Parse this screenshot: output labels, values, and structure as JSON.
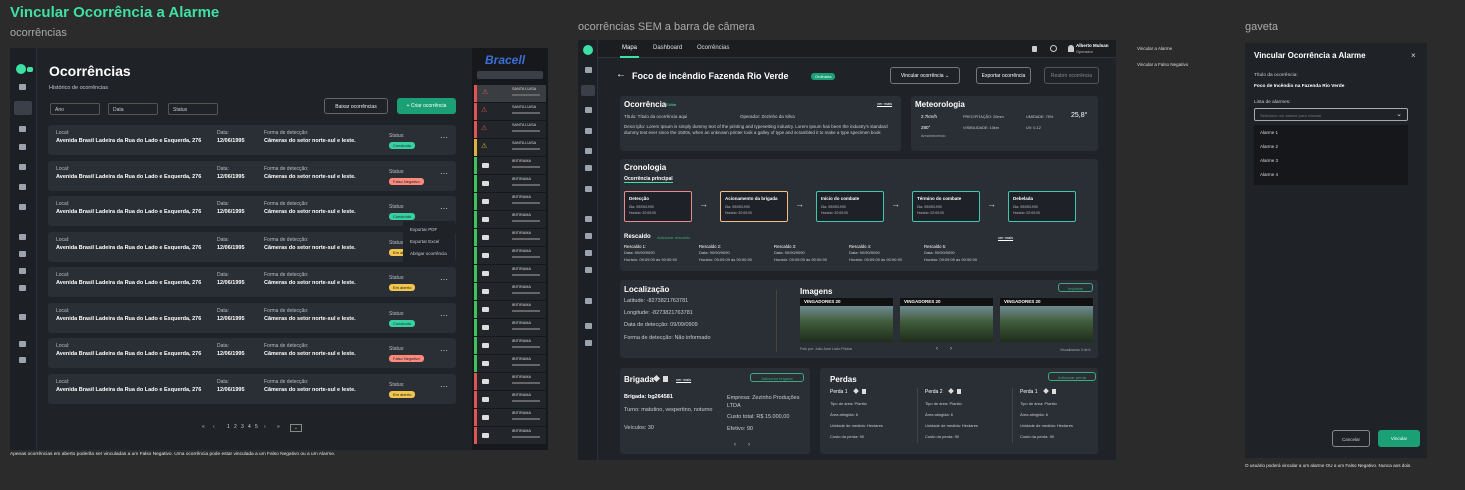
{
  "title": "Vincular Ocorrência a Alarme",
  "frames": {
    "f1": "ocorrências",
    "f2": "ocorrências SEM a barra de câmera",
    "f3": "gaveta"
  },
  "list": {
    "page_title": "Ocorrências",
    "subtitle": "Histórico de ocorrências",
    "filters": [
      "Ano",
      "Data",
      "Status"
    ],
    "download_label": "Baixar ocorrências",
    "create_label": "+ Criar ocorrência",
    "rows": [
      {
        "local_label": "Local:",
        "local": "Avenida Brasil Ladeira da Rua do Lado e Esquerda, 276",
        "data_label": "Data:",
        "data": "12/06/1995",
        "forma_label": "Forma de detecção:",
        "forma": "Câmeras do setor norte-sul e leste.",
        "status_label": "Status:",
        "status": "Concluído",
        "color": "#39d0a0"
      },
      {
        "local_label": "Local:",
        "local": "Avenida Brasil Ladeira da Rua do Lado e Esquerda, 276",
        "data_label": "Data:",
        "data": "12/06/1995",
        "forma_label": "Forma de detecção:",
        "forma": "Câmeras do setor norte-sul e leste.",
        "status_label": "Status:",
        "status": "Falso Negativo",
        "color": "#ff8a7a"
      },
      {
        "local_label": "Local:",
        "local": "Avenida Brasil Ladeira da Rua do Lado e Esquerda, 276",
        "data_label": "Data:",
        "data": "12/06/1995",
        "forma_label": "Forma de detecção:",
        "forma": "Câmeras do setor norte-sul e leste.",
        "status_label": "Status:",
        "status": "Concluído",
        "color": "#39d0a0"
      },
      {
        "local_label": "Local:",
        "local": "Avenida Brasil Ladeira da Rua do Lado e Esquerda, 276",
        "data_label": "Data:",
        "data": "12/06/1995",
        "forma_label": "Forma de detecção:",
        "forma": "Câmeras do setor norte-sul e leste.",
        "status_label": "Status:",
        "status": "Em aberto",
        "color": "#f3c54a"
      },
      {
        "local_label": "Local:",
        "local": "Avenida Brasil Ladeira da Rua do Lado e Esquerda, 276",
        "data_label": "Data:",
        "data": "12/06/1995",
        "forma_label": "Forma de detecção:",
        "forma": "Câmeras do setor norte-sul e leste.",
        "status_label": "Status:",
        "status": "Em aberto",
        "color": "#f3c54a"
      },
      {
        "local_label": "Local:",
        "local": "Avenida Brasil Ladeira da Rua do Lado e Esquerda, 276",
        "data_label": "Data:",
        "data": "12/06/1995",
        "forma_label": "Forma de detecção:",
        "forma": "Câmeras do setor norte-sul e leste.",
        "status_label": "Status:",
        "status": "Concluído",
        "color": "#39d0a0"
      },
      {
        "local_label": "Local:",
        "local": "Avenida Brasil Ladeira da Rua do Lado e Esquerda, 276",
        "data_label": "Data:",
        "data": "12/06/1995",
        "forma_label": "Forma de detecção:",
        "forma": "Câmeras do setor norte-sul e leste.",
        "status_label": "Status:",
        "status": "Falso Negativo",
        "color": "#ff8a7a"
      },
      {
        "local_label": "Local:",
        "local": "Avenida Brasil Ladeira da Rua do Lado e Esquerda, 276",
        "data_label": "Data:",
        "data": "12/06/1995",
        "forma_label": "Forma de detecção:",
        "forma": "Câmeras do setor norte-sul e leste.",
        "status_label": "Status:",
        "status": "Em aberto",
        "color": "#f3c54a"
      }
    ],
    "menu": [
      "Exportar PDF",
      "Exportar Excel",
      "Abrigar ocorrência"
    ],
    "pagination": [
      "«",
      "‹",
      "1",
      "2",
      "3",
      "4",
      "5",
      "›",
      "»",
      "⌄"
    ],
    "footnote": "Apenas ocorrências em aberto poderão ser vinculadas a um Falso Negativo. Uma ocorrência pode estar vinculada a um Falso Negativo ou a um Alarme.",
    "brand": "Bracell",
    "alarms": [
      {
        "label": "SANTA LUISA",
        "color": "#e05454",
        "icon": "x"
      },
      {
        "label": "SANTA LUISA",
        "color": "#e05454",
        "icon": "!"
      },
      {
        "label": "SANTA LUISA",
        "color": "#e05454",
        "icon": "!"
      },
      {
        "label": "SANTA LUISA",
        "color": "#e0b13c",
        "icon": "!"
      },
      {
        "label": "IBITIRAMA",
        "color": "#3bc45a",
        "icon": "c"
      },
      {
        "label": "IBITIRAMA",
        "color": "#3bc45a",
        "icon": "c"
      },
      {
        "label": "IBITIRAMA",
        "color": "#3bc45a",
        "icon": "c"
      },
      {
        "label": "IBITIRAMA",
        "color": "#3bc45a",
        "icon": "c"
      },
      {
        "label": "IBITIRAMA",
        "color": "#3bc45a",
        "icon": "c"
      },
      {
        "label": "IBITIRAMA",
        "color": "#3bc45a",
        "icon": "c"
      },
      {
        "label": "IBITIRAMA",
        "color": "#3bc45a",
        "icon": "c"
      },
      {
        "label": "IBITIRAMA",
        "color": "#3bc45a",
        "icon": "c"
      },
      {
        "label": "IBITIRAMA",
        "color": "#3bc45a",
        "icon": "c"
      },
      {
        "label": "IBITIRAMA",
        "color": "#3bc45a",
        "icon": "c"
      },
      {
        "label": "IBITIRAMA",
        "color": "#3bc45a",
        "icon": "c"
      },
      {
        "label": "IBITIRAMA",
        "color": "#3bc45a",
        "icon": "c"
      },
      {
        "label": "IBITIRAMA",
        "color": "#e05454",
        "icon": "c"
      },
      {
        "label": "IBITIRAMA",
        "color": "#e05454",
        "icon": "c"
      },
      {
        "label": "IBITIRAMA",
        "color": "#e05454",
        "icon": "c"
      },
      {
        "label": "IBITIRAMA",
        "color": "#e05454",
        "icon": "c"
      }
    ]
  },
  "detail": {
    "nav": [
      "Mapa",
      "Dashboard",
      "Ocorrências"
    ],
    "user_name": "Alberto Mulsan",
    "user_role": "Operador",
    "title": "Foco de incêndio Fazenda Rio Verde",
    "badge": "Ordinária",
    "link_label": "Vincular ocorrência",
    "export_label": "Exportar ocorrência",
    "reopen_label": "Reabrir ocorrência",
    "occ": {
      "h": "Ocorrência",
      "edit": "Editar",
      "more": "ver mais",
      "title": "Título: Título da ocorrência aqui",
      "operator": "Operador: Zezinho da Silva",
      "desc": "Descrição: Lorem Ipsum is simply dummy text of the printing and typesetting industry. Lorem Ipsum has been the industry's standard dummy text ever since the 1500s, when an unknown printer took a galley of type and scrambled it to make a type specimen book"
    },
    "meteo": {
      "h": "Meteorologia",
      "wind": "2.7km/h",
      "rain": "PRECIPITAÇÃO: 20mm",
      "hum": "UMIDADE: 75%",
      "temp": "25,8°",
      "dir": "280°",
      "vis": "VISIBILIDADE: 10km",
      "uv": "UV: 0-12",
      "dir_label": "Amanhecendo"
    },
    "crono": {
      "h": "Cronologia",
      "sub": "Ocorrência principal"
    },
    "steps": [
      {
        "t": "Detecção",
        "a": "Dia: 05/05/1990",
        "b": "Horário: 20:00:00",
        "c": "#e98b8b"
      },
      {
        "t": "Acionamento da brigada",
        "a": "Dia: 05/05/1990",
        "b": "Horário: 20:00:00",
        "c": "#f0c08a"
      },
      {
        "t": "Início do combate",
        "a": "Dia: 05/05/1990",
        "b": "Horário: 20:00:00",
        "c": "#3fc7b0"
      },
      {
        "t": "Término do combate",
        "a": "Dia: 05/05/1990",
        "b": "Horário: 02:00:00",
        "c": "#3fc7b0"
      },
      {
        "t": "Debelada",
        "a": "Dia: 05/05/1990",
        "b": "Horário: 02:00:00",
        "c": "#3fc7b0"
      }
    ],
    "rescue": {
      "h": "Rescaldo",
      "add": "Adicionar rescaldo",
      "more": "ver mais"
    },
    "rescues": [
      {
        "t": "Rescaldo 1:",
        "a": "Data: 90/90/9090",
        "b": "Horário: 09:09:09 às 90:90:90"
      },
      {
        "t": "Rescaldo 2:",
        "a": "Data: 90/90/9090",
        "b": "Horário: 09:09:09 às 90:90:90"
      },
      {
        "t": "Rescaldo 3:",
        "a": "Data: 90/90/9090",
        "b": "Horário: 09:09:09 às 90:90:90"
      },
      {
        "t": "Rescaldo 4:",
        "a": "Data: 90/90/9090",
        "b": "Horário: 09:09:09 às 90:90:90"
      },
      {
        "t": "Rescaldo 5:",
        "a": "Data: 90/90/9090",
        "b": "Horário: 09:09:09 às 90:90:90"
      }
    ],
    "loc": {
      "h": "Localização",
      "lat": "Latitude: -8273821763781",
      "lon": "Longitude: -8273821763781",
      "date": "Data de detecção: 09/09/0909",
      "form": "Forma de detecção: Não informado"
    },
    "images": {
      "h": "Imagens",
      "import": "Importar",
      "cards": [
        "VINGADORES 20",
        "VINGADORES 20",
        "VINGADORES 20"
      ],
      "credit": "Foto por: João José Lúcio Photos",
      "count": "Visualizando 3 de 6"
    },
    "brig": {
      "h": "Brigada",
      "more": "ver mais",
      "add": "Adicionar brigada",
      "code": "Brigada: bg264581",
      "turn": "Turno: matutino, vespertino, noturno",
      "veh": "Veículos: 30",
      "comp": "Empresa: Zezinho Produções LTDA",
      "cost": "Custo total: R$ 15.000,00",
      "eff": "Efetivo: 90"
    },
    "losses": {
      "h": "Perdas",
      "add": "Adicionar perda"
    },
    "loss_items": [
      {
        "t": "Perda 1",
        "a": "Tipo de área: Plantio",
        "b": "Área atingida: 6",
        "c": "Unidade de medida: Hectares",
        "d": "Custo da perda: 90"
      },
      {
        "t": "Perda 2",
        "a": "Tipo de área: Plantio",
        "b": "Área atingida: 6",
        "c": "Unidade de medida: Hectares",
        "d": "Custo da perda: 90"
      },
      {
        "t": "Perda 1",
        "a": "Tipo de área: Plantio",
        "b": "Área atingida: 6",
        "c": "Unidade de medida: Hectares",
        "d": "Custo da perda: 90"
      }
    ]
  },
  "side_links": [
    "Vincular a Alarme",
    "Vincular a Falso Negativo"
  ],
  "drawer": {
    "title": "Vincular Ocorrência a Alarme",
    "occ_label": "Título da ocorrência:",
    "occ_value": "Foco de Incêndio na Fazenda Rio Verde",
    "list_label": "Lista de alarmes:",
    "placeholder": "Selecione um alarme para vincular",
    "options": [
      "Alarme 1",
      "Alarme 2",
      "Alarme 3",
      "Alarme 4"
    ],
    "cancel": "Cancelar",
    "confirm": "Vincular",
    "note": "O usuário poderá vincular a um alarme OU a um Falso Negativo. Nunca aos dois."
  }
}
